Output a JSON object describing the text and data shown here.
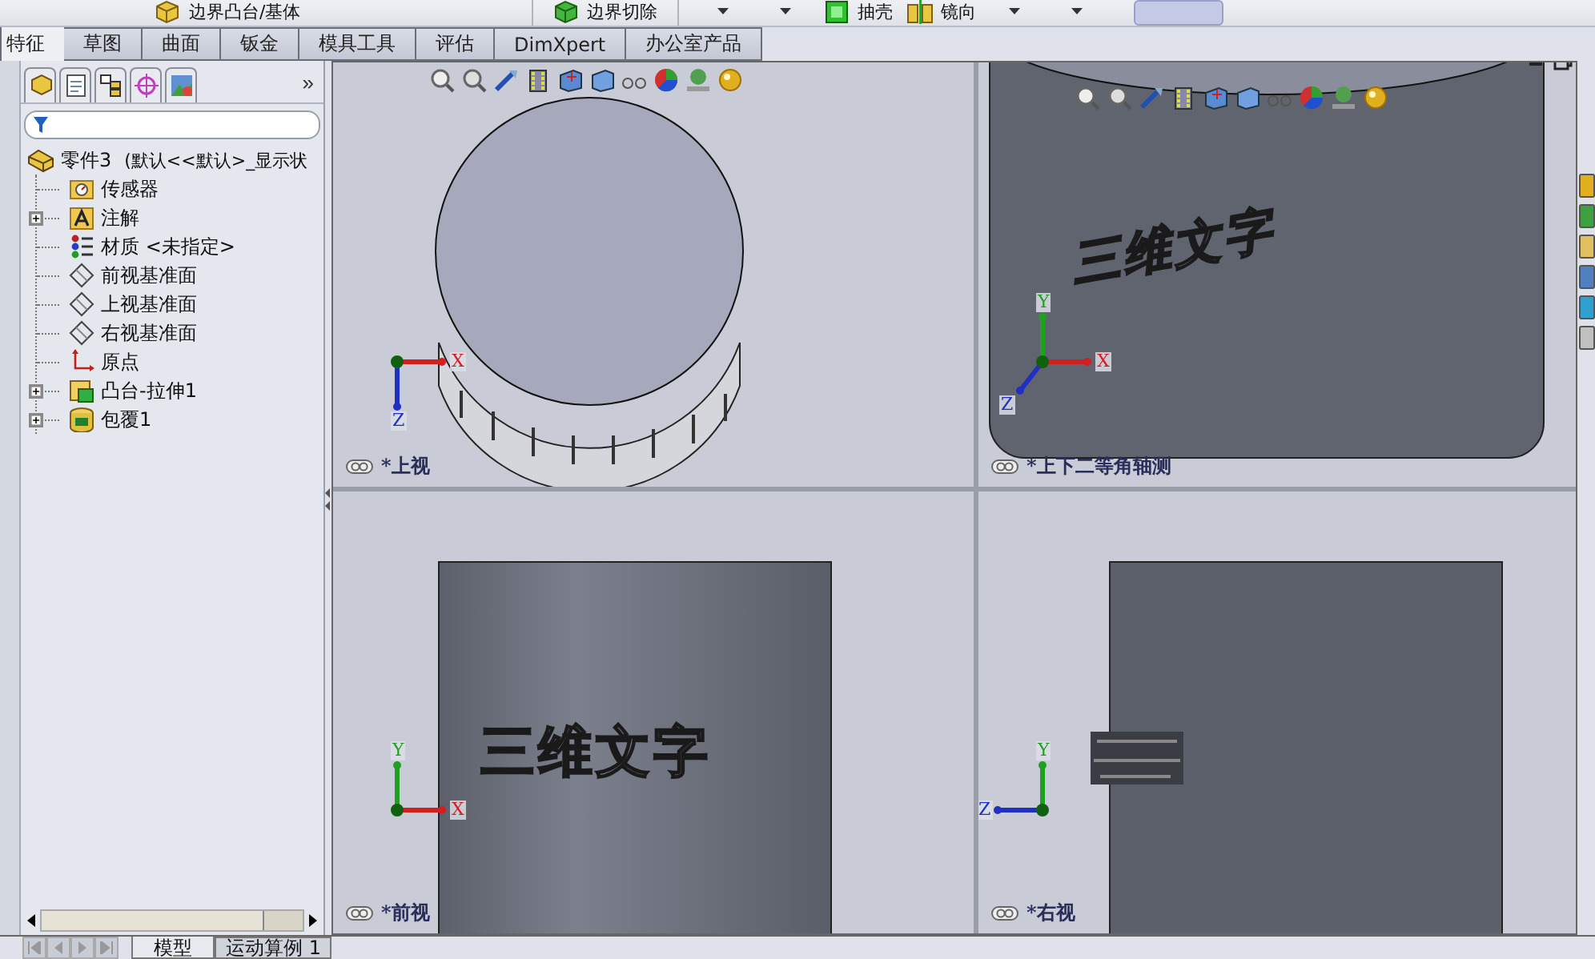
{
  "toolbar": {
    "buttons": [
      {
        "label": "边界凸台/基体",
        "kind": "boss"
      },
      {
        "label": "边界切除",
        "kind": "cut"
      },
      {
        "label": "抽壳",
        "kind": "shell"
      },
      {
        "label": "镜向",
        "kind": "mirror"
      }
    ]
  },
  "command_tabs": [
    {
      "label": "特征",
      "selected": true
    },
    {
      "label": "草图",
      "selected": false
    },
    {
      "label": "曲面",
      "selected": false
    },
    {
      "label": "钣金",
      "selected": false
    },
    {
      "label": "模具工具",
      "selected": false
    },
    {
      "label": "评估",
      "selected": false
    },
    {
      "label": "DimXpert",
      "selected": false
    },
    {
      "label": "办公室产品",
      "selected": false
    }
  ],
  "feature_manager": {
    "more": "»",
    "tree": {
      "label": "零件3",
      "config": "(默认<<默认>_显示状",
      "children": [
        {
          "label": "传感器",
          "kind": "sensor"
        },
        {
          "label": "注解",
          "kind": "annotation",
          "expanded": false
        },
        {
          "label": "材质 <未指定>",
          "kind": "material"
        },
        {
          "label": "前视基准面",
          "kind": "plane"
        },
        {
          "label": "上视基准面",
          "kind": "plane"
        },
        {
          "label": "右视基准面",
          "kind": "plane"
        },
        {
          "label": "原点",
          "kind": "origin"
        },
        {
          "label": "凸台-拉伸1",
          "kind": "extrude",
          "expanded": false
        },
        {
          "label": "包覆1",
          "kind": "wrap",
          "expanded": false
        }
      ]
    }
  },
  "viewports": [
    {
      "kind": "top",
      "label": "*上视",
      "triad": [
        {
          "axis": "X",
          "color": "#d02020"
        },
        {
          "axis": "Z",
          "color": "#2030c0"
        }
      ]
    },
    {
      "kind": "iso",
      "label": "*上下二等角轴测",
      "model_text": "三维文字",
      "triad": [
        {
          "axis": "Y",
          "color": "#20a020"
        },
        {
          "axis": "X",
          "color": "#d02020"
        },
        {
          "axis": "Z",
          "color": "#2030c0"
        }
      ]
    },
    {
      "kind": "front",
      "label": "*前视",
      "model_text": "三维文字",
      "triad": [
        {
          "axis": "Y",
          "color": "#20a020"
        },
        {
          "axis": "X",
          "color": "#d02020"
        }
      ]
    },
    {
      "kind": "right",
      "label": "*右视",
      "triad": [
        {
          "axis": "Y",
          "color": "#20a020"
        },
        {
          "axis": "Z",
          "color": "#2030c0"
        }
      ]
    }
  ],
  "bottom_tabs": [
    {
      "label": "模型",
      "selected": true
    },
    {
      "label": "运动算例 1",
      "selected": false
    }
  ]
}
